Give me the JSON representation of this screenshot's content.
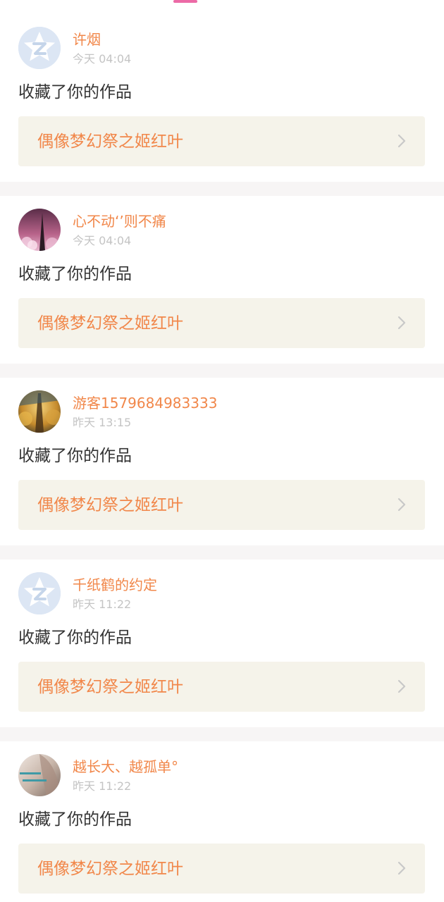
{
  "colors": {
    "accent": "#f1874a",
    "indicator": "#ec6aa6",
    "card_link_bg": "#f5f3ea",
    "divider": "#f7f5f5",
    "time_text": "#c4c4c4",
    "body_text": "#333333"
  },
  "notifications": [
    {
      "username": "许烟",
      "time": "今天 04:04",
      "action": "收藏了你的作品",
      "work_title": "偶像梦幻祭之姬红叶",
      "avatar": "default-star-avatar",
      "chevron_icon": "chevron-right-icon"
    },
    {
      "username": "心不动‘’则不痛",
      "time": "今天 04:04",
      "action": "收藏了你的作品",
      "work_title": "偶像梦幻祭之姬红叶",
      "avatar": "night-tower-avatar",
      "chevron_icon": "chevron-right-icon"
    },
    {
      "username": "游客1579684983333",
      "time": "昨天 13:15",
      "action": "收藏了你的作品",
      "work_title": "偶像梦幻祭之姬红叶",
      "avatar": "golden-tower-avatar",
      "chevron_icon": "chevron-right-icon"
    },
    {
      "username": "千纸鹤的约定",
      "time": "昨天 11:22",
      "action": "收藏了你的作品",
      "work_title": "偶像梦幻祭之姬红叶",
      "avatar": "default-star-avatar",
      "chevron_icon": "chevron-right-icon"
    },
    {
      "username": "越长大、越孤单°",
      "time": "昨天 11:22",
      "action": "收藏了你的作品",
      "work_title": "偶像梦幻祭之姬红叶",
      "avatar": "photo-text-avatar",
      "chevron_icon": "chevron-right-icon"
    }
  ]
}
